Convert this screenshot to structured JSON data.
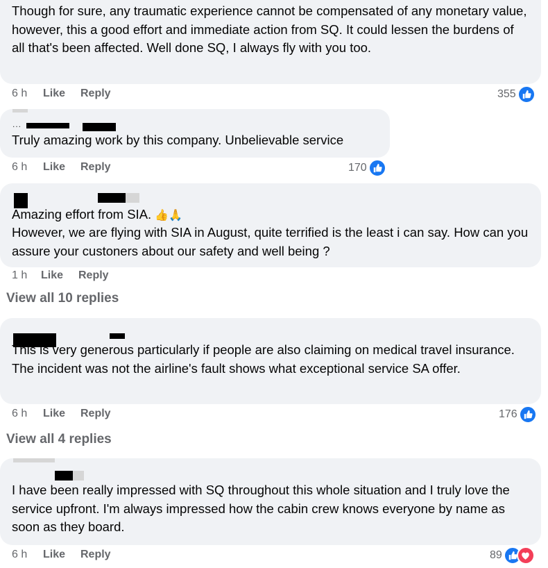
{
  "comments": [
    {
      "text": "Though for sure, any traumatic experience cannot be compensated of any monetary value, however, this a good effort and immediate action from SQ. It could lessen the burdens of all that's been affected. Well done SQ, I always fly with you too.",
      "time": "6 h",
      "like_label": "Like",
      "reply_label": "Reply",
      "reaction_count": "355",
      "reactions": [
        "like-icon"
      ]
    },
    {
      "ellipsis": "...",
      "text": "Truly amazing work by this company. Unbelievable service",
      "time": "6 h",
      "like_label": "Like",
      "reply_label": "Reply",
      "reaction_count": "170",
      "reactions": [
        "like-icon"
      ]
    },
    {
      "text_line1": "Amazing effort from SIA.",
      "emojis": "👍🙏",
      "text_rest": "However, we are flying with SIA in August, quite terrified is the least i can say. How can you assure your custoners about our safety and well being ?",
      "time": "1 h",
      "like_label": "Like",
      "reply_label": "Reply",
      "view_replies": "View all 10 replies"
    },
    {
      "text": "This is very generous particularly if people are also claiming on medical travel insurance. The incident was not the airline's fault shows what exceptional service SA offer.",
      "time": "6 h",
      "like_label": "Like",
      "reply_label": "Reply",
      "reaction_count": "176",
      "reactions": [
        "like-icon"
      ],
      "view_replies": "View all 4 replies"
    },
    {
      "text": "I have been really impressed with SQ throughout this whole situation and I truly love the service upfront. I'm always impressed how the cabin crew knows everyone by name as soon as they board.",
      "time": "6 h",
      "like_label": "Like",
      "reply_label": "Reply",
      "reaction_count": "89",
      "reactions": [
        "like-icon",
        "love-icon"
      ]
    }
  ],
  "colors": {
    "bubble": "#f0f2f5",
    "meta_text": "#65676b",
    "like_blue": "#1877f2",
    "love_red": "#f33e58"
  }
}
